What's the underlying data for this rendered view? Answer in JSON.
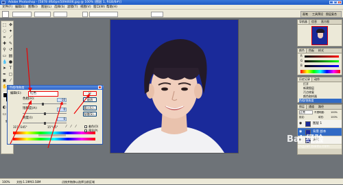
{
  "window": {
    "title": "Adobe Photoshop - [5878 4fb0pni5094606.jpg @ 100% (图层 1, RGB/8#)]"
  },
  "menu": [
    "文件(F)",
    "编辑(E)",
    "图像(I)",
    "图层(L)",
    "选择(S)",
    "滤镜(T)",
    "视图(V)",
    "窗口(W)",
    "帮助(H)"
  ],
  "options_bar": {
    "fields": [
      "",
      "",
      "",
      "",
      ""
    ],
    "label": "",
    "workspace_tabs": [
      "画笔",
      "工具预设",
      "图层复合"
    ]
  },
  "dialog": {
    "title": "色相/饱和度",
    "edit_label": "编辑(E):",
    "edit_value": "红色",
    "hue_label": "色相(H):",
    "hue_value": "-10",
    "saturation_label": "饱和度(A):",
    "saturation_value": "0",
    "lightness_label": "明度(I):",
    "lightness_value": "0",
    "range_left": "315°/345°",
    "range_right": "15°\\45°",
    "ok_label": "好",
    "cancel_label": "取消",
    "load_label": "载入(L)...",
    "save_label": "存储(S)...",
    "colorize_label": "着色(O)",
    "preview_label": "预览(P)",
    "preview_checked": true
  },
  "right_panels": {
    "navigator": {
      "tabs": [
        "导航器",
        "信息",
        "直方图"
      ]
    },
    "color": {
      "tabs": [
        "颜色",
        "色板",
        "样式"
      ],
      "channels": [
        "R",
        "G",
        "B"
      ]
    },
    "history": {
      "tabs": [
        "历史记录",
        "动作"
      ],
      "items": [
        "打开",
        "新建图层",
        "污点修复",
        "颜色取样器",
        "色相/饱和度"
      ]
    },
    "layers": {
      "tabs": [
        "图层",
        "通道",
        "路径"
      ],
      "blend_mode": "正常",
      "opacity_label": "不透明度:",
      "opacity_value": "100%",
      "fill_label": "填充:",
      "fill_value": "100%",
      "lock_label": "锁定:",
      "rows": [
        {
          "name": "图层 1"
        },
        {
          "name": "背景 副本"
        },
        {
          "name": "背景"
        }
      ]
    }
  },
  "statusbar": {
    "zoom": "100%",
    "doc": "文档:1.19M/3.58M",
    "hint": "点按并拖移以选择当前区域"
  },
  "watermark": {
    "text": "Bai 经验",
    "sub": "jingyan.baidu.com"
  },
  "colors": {
    "canvas_bg": "#1a2a9a",
    "titlebar": "#1e5bc6",
    "ui_bg": "#ece9d8",
    "workspace": "#6e7378",
    "highlight_red": "#e00000"
  }
}
